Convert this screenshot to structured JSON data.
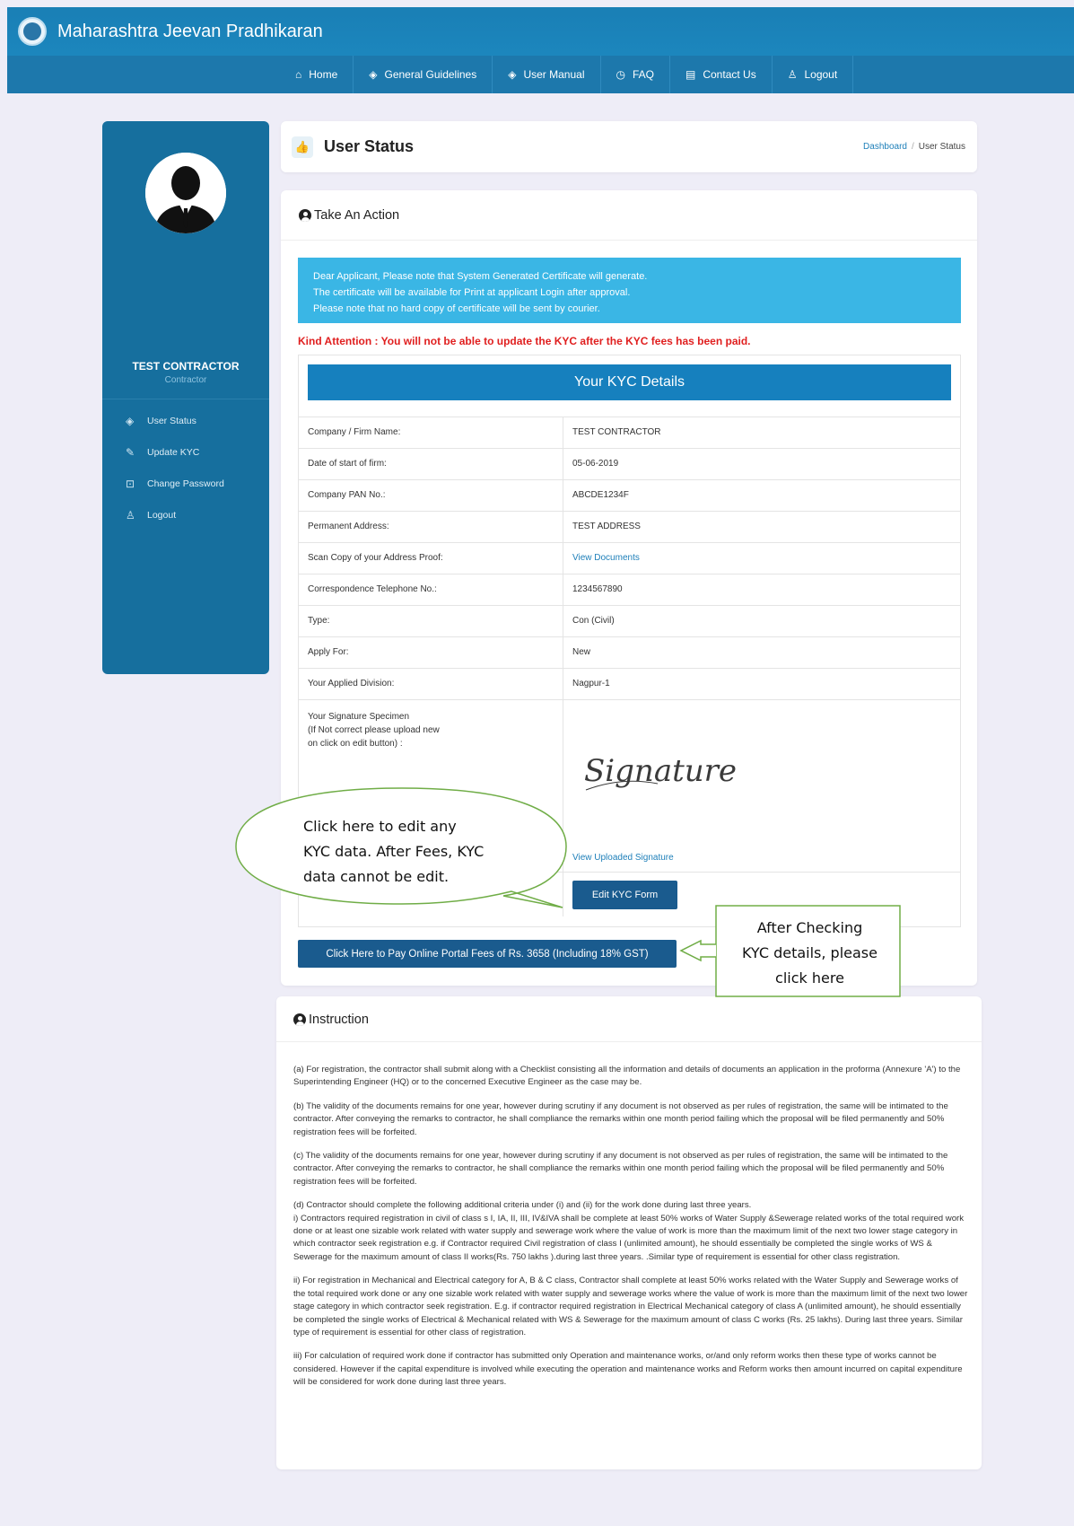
{
  "app": {
    "title": "Maharashtra Jeevan Pradhikaran"
  },
  "nav": [
    {
      "label": "Home",
      "icon": "home-icon",
      "glyph": "⌂"
    },
    {
      "label": "General Guidelines",
      "icon": "layers-icon",
      "glyph": "◈"
    },
    {
      "label": "User Manual",
      "icon": "layers-icon",
      "glyph": "◈"
    },
    {
      "label": "FAQ",
      "icon": "clock-icon",
      "glyph": "◷"
    },
    {
      "label": "Contact Us",
      "icon": "document-icon",
      "glyph": "▤"
    },
    {
      "label": "Logout",
      "icon": "user-icon",
      "glyph": "♙"
    }
  ],
  "sidebar": {
    "user_name": "TEST CONTRACTOR",
    "user_role": "Contractor",
    "items": [
      {
        "label": "User Status",
        "icon": "layers-icon",
        "glyph": "◈"
      },
      {
        "label": "Update KYC",
        "icon": "edit-icon",
        "glyph": "✎"
      },
      {
        "label": "Change Password",
        "icon": "lock-icon",
        "glyph": "⊡"
      },
      {
        "label": "Logout",
        "icon": "logout-icon",
        "glyph": "♙"
      }
    ]
  },
  "status": {
    "title": "User Status",
    "icon_glyph": "👍",
    "breadcrumb": [
      "Dashboard",
      "User Status"
    ]
  },
  "action": {
    "title": "Take An Action",
    "alert_lines": [
      "Dear Applicant, Please note that System Generated Certificate will generate.",
      "The certificate will be available for Print at applicant Login after approval.",
      "Please note that no hard copy of certificate will be sent by courier."
    ],
    "kind_attention": "Kind Attention : You will not be able to update the KYC after the KYC fees has been paid.",
    "kyc_title": "Your KYC Details",
    "kyc_rows": [
      {
        "label": "Company / Firm Name:",
        "value": "TEST CONTRACTOR"
      },
      {
        "label": "Date of start of firm:",
        "value": "05-06-2019"
      },
      {
        "label": "Company PAN No.:",
        "value": "ABCDE1234F"
      },
      {
        "label": "Permanent Address:",
        "value": "TEST ADDRESS"
      },
      {
        "label": "Scan Copy of your Address Proof:",
        "value": "View Documents"
      },
      {
        "label": "Correspondence Telephone No.:",
        "value": "1234567890"
      },
      {
        "label": "Type:",
        "value": "Con (Civil)"
      },
      {
        "label": "Apply For:",
        "value": "New"
      },
      {
        "label": "Your Applied Division:",
        "value": "Nagpur-1"
      }
    ],
    "signature_label_lines": [
      "Your Signature Specimen",
      "(If Not correct please upload new",
      "on click on edit button) :"
    ],
    "signature_text": "Signature",
    "view_signature": "View Uploaded Signature",
    "edit_button": "Edit KYC Form",
    "pay_button": "Click Here to Pay Online Portal Fees of Rs. 3658 (Including 18% GST)"
  },
  "instruction": {
    "title": "Instruction",
    "paragraphs": [
      "(a) For registration, the contractor shall submit along with a Checklist consisting all the information and details of documents an application in the proforma (Annexure 'A') to the Superintending Engineer (HQ) or to the concerned Executive Engineer as the case may be.",
      "(b) The validity of the documents remains for one year, however during scrutiny if any document is not observed as per rules of registration, the same will be intimated to the contractor. After conveying the remarks to contractor, he shall compliance the remarks within one month period failing which the proposal will be filed permanently and 50% registration fees will be forfeited.",
      "(c) The validity of the documents remains for one year, however during scrutiny if any document is not observed as per rules of registration, the same will be intimated to the contractor. After conveying the remarks to contractor, he shall compliance the remarks within one month period failing which the proposal will be filed permanently and 50% registration fees will be forfeited.",
      "(d) Contractor should complete the following additional criteria under (i) and (ii) for the work done during last three years.\ni) Contractors required registration in civil of class s I, IA, II, III, IV&IVA shall be complete at least 50% works of Water Supply &Sewerage related works of the total required work done or at least one sizable work related with water supply and sewerage work where the value of work is more than the maximum limit of the next two lower stage category in which contractor seek registration e.g. if Contractor required Civil registration of class I (unlimited amount), he should essentially be completed the single works of WS & Sewerage for the maximum amount of class II works(Rs. 750 lakhs ).during last three years. .Similar type of requirement is essential for other class registration.",
      "ii) For registration in Mechanical and Electrical category for A, B & C class, Contractor shall complete at least 50% works related with the Water Supply and Sewerage works of the total required work done or any one sizable work related with water supply and sewerage works where the value of work is more than the maximum limit of the next two lower stage category in which contractor seek registration. E.g. if contractor required registration in Electrical Mechanical category of class A (unlimited amount), he should essentially be completed the single works of Electrical & Mechanical related with WS & Sewerage for the maximum amount of class C works (Rs. 25 lakhs). During last three years. Similar type of requirement is essential for other class of registration.",
      "iii) For calculation of required work done if contractor has submitted only Operation and maintenance works, or/and only reform works then these type of works cannot be considered. However if the capital expenditure is involved while executing the operation and maintenance works and Reform works then amount incurred on capital expenditure will be considered for work done during last three years."
    ]
  },
  "callouts": {
    "edit_lines": [
      "Click here to edit any",
      "KYC data. After Fees, KYC",
      "data cannot be edit."
    ],
    "pay_lines": [
      "After Checking",
      "KYC details, please",
      "click here"
    ],
    "color": "#70ad47"
  }
}
